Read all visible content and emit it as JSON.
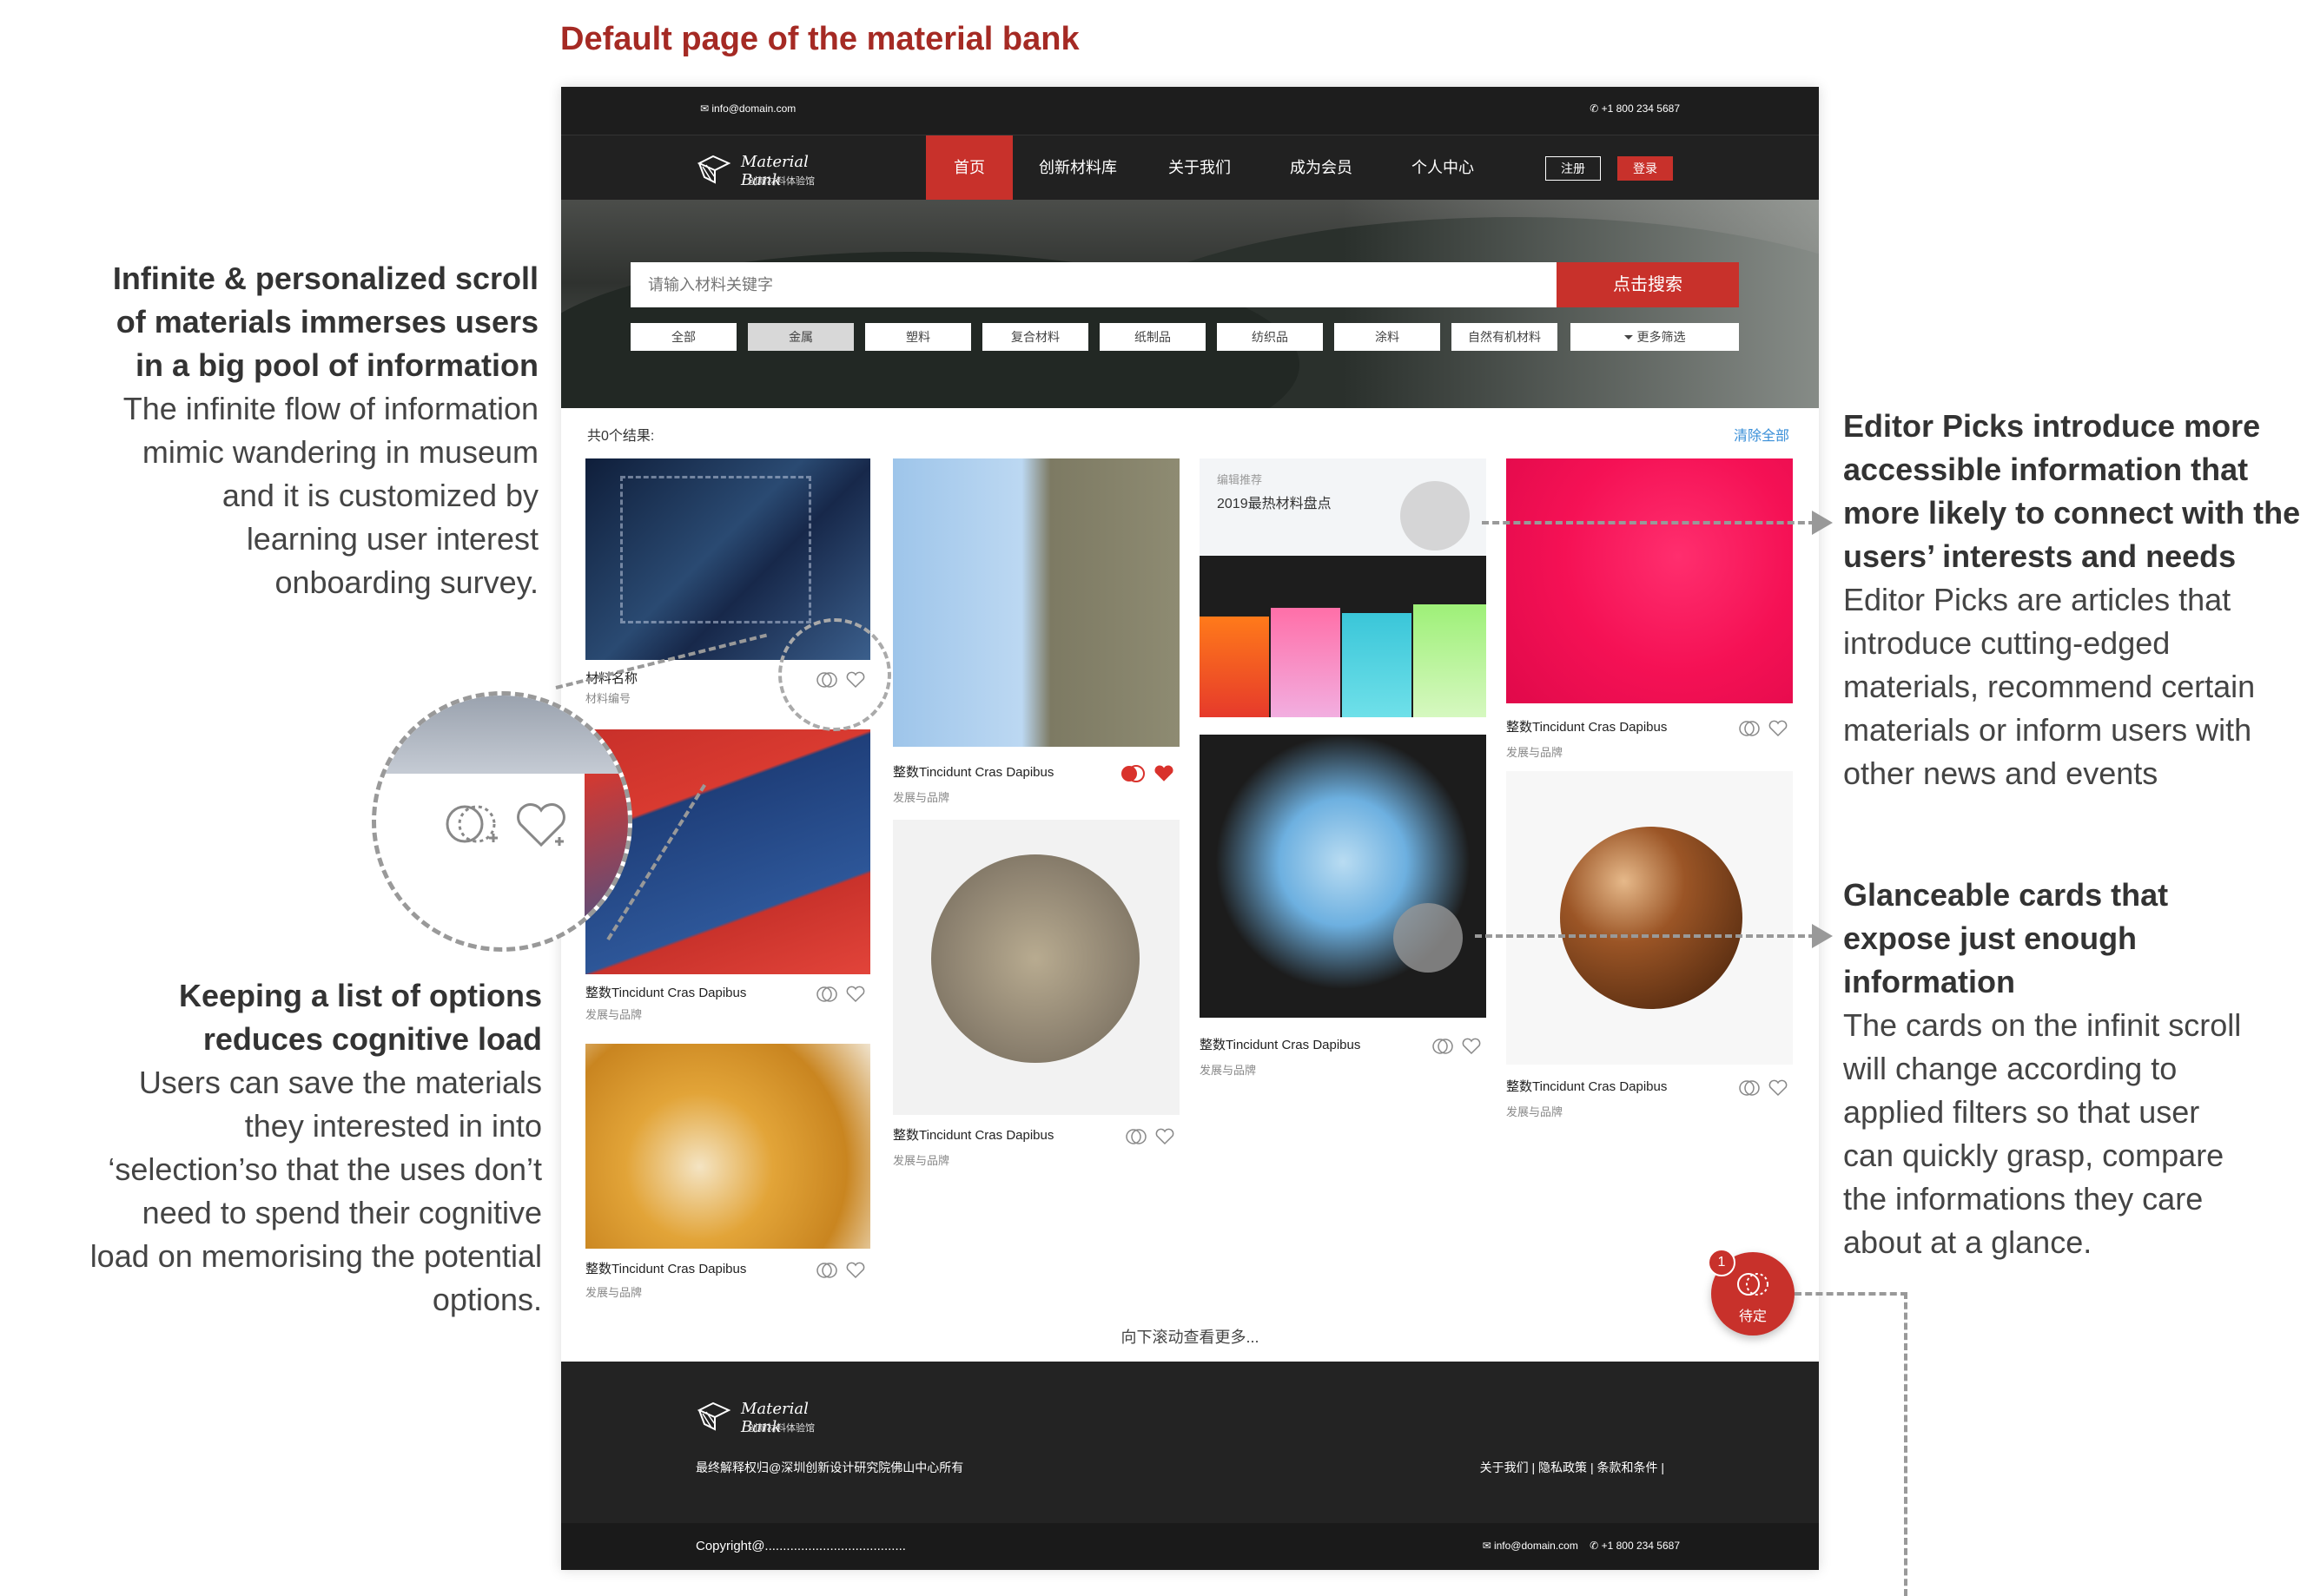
{
  "page_heading": "Default page of the material bank",
  "header": {
    "email": "info@domain.com",
    "phone": "+1 800 234 5687",
    "logo_name": "Material Bank",
    "logo_sub": "创新材料体验馆",
    "nav": [
      "首页",
      "创新材料库",
      "关于我们",
      "成为会员",
      "个人中心"
    ],
    "register": "注册",
    "login": "登录"
  },
  "search": {
    "placeholder": "请输入材料关键字",
    "button": "点击搜索",
    "filters": [
      "全部",
      "金属",
      "塑料",
      "复合材料",
      "纸制品",
      "纺织品",
      "涂料",
      "自然有机材料",
      "更多筛选"
    ]
  },
  "results": {
    "count_text": "共0个结果:",
    "clear_all": "清除全部",
    "cards": [
      {
        "title": "材料名称",
        "sub": "材料编号"
      },
      {
        "title": "整数Tincidunt Cras Dapibus",
        "sub": "发展与品牌"
      },
      {
        "title": "整数Tincidunt Cras Dapibus",
        "sub": "发展与品牌"
      },
      {
        "title": "整数Tincidunt Cras Dapibus",
        "sub": "发展与品牌"
      },
      {
        "title": "整数Tincidunt Cras Dapibus",
        "sub": "发展与品牌"
      },
      {
        "title": "整数Tincidunt Cras Dapibus",
        "sub": "发展与品牌"
      },
      {
        "title": "整数Tincidunt Cras Dapibus",
        "sub": "发展与品牌"
      },
      {
        "title": "整数Tincidunt Cras Dapibus",
        "sub": "发展与品牌"
      }
    ],
    "editor_pick": {
      "label": "编辑推荐",
      "title": "2019最热材料盘点"
    },
    "scroll_more": "向下滚动查看更多...",
    "pending": {
      "count": "1",
      "label": "待定"
    }
  },
  "footer": {
    "logo_name": "Material Bank",
    "logo_sub": "创新材料体验馆",
    "rights": "最终解释权归@深圳创新设计研究院佛山中心所有",
    "links": "关于我们 | 隐私政策 | 条款和条件 |",
    "copyright": "Copyright@.......................................",
    "email": "info@domain.com",
    "phone": "+1 800 234 5687"
  },
  "annotations": {
    "infinite": {
      "head": [
        "Infinite & personalized scroll",
        "of materials immerses users",
        "in a big pool of information"
      ],
      "body": [
        "The infinite flow of information",
        "mimic wandering in museum",
        "and it is customized by",
        "learning user interest",
        "onboarding survey."
      ]
    },
    "options": {
      "head": [
        "Keeping a list of options",
        "reduces cognitive load"
      ],
      "body": [
        "Users can save the materials",
        "they interested in into",
        "‘selection’so that the uses don’t",
        "need to spend their cognitive",
        "load on memorising the potential",
        "options."
      ]
    },
    "editor": {
      "head": [
        "Editor Picks introduce more",
        "accessible information that",
        "more likely to connect with the",
        "users’ interests and needs"
      ],
      "body": [
        "Editor Picks are articles that",
        "introduce cutting-edged",
        "materials, recommend certain",
        "materials or inform users with",
        "other news and events"
      ]
    },
    "glance": {
      "head": [
        "Glanceable cards that",
        "expose just enough",
        "information"
      ],
      "body": [
        "The cards on the infinit scroll",
        "will change according to",
        "applied filters so that user",
        "can quickly grasp, compare",
        "the informations they care",
        "about at a glance."
      ]
    }
  },
  "colors": {
    "accent": "#c8312b",
    "heading": "#a52a24",
    "link": "#3a8fd8"
  }
}
